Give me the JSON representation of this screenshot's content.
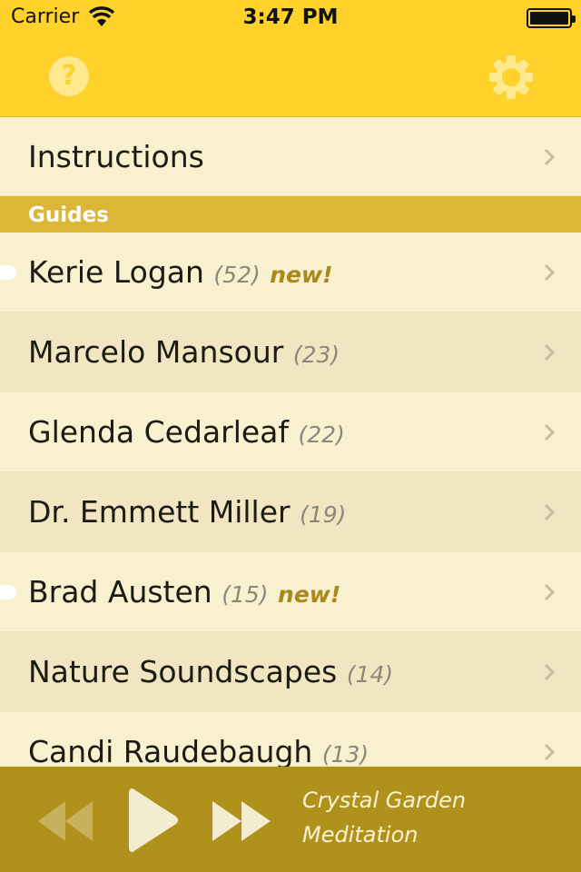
{
  "status_bar": {
    "carrier": "Carrier",
    "time": "3:47 PM"
  },
  "nav": {
    "help_symbol": "?",
    "help_icon": "question-circle-icon",
    "settings_icon": "gear-icon"
  },
  "instructions": {
    "label": "Instructions"
  },
  "guides_section": {
    "title": "Guides"
  },
  "guides": [
    {
      "name": "Kerie Logan",
      "count": "(52)",
      "badge": "new!",
      "unread": true
    },
    {
      "name": "Marcelo Mansour",
      "count": "(23)",
      "badge": "",
      "unread": false
    },
    {
      "name": "Glenda Cedarleaf",
      "count": "(22)",
      "badge": "",
      "unread": false
    },
    {
      "name": "Dr. Emmett Miller",
      "count": "(19)",
      "badge": "",
      "unread": false
    },
    {
      "name": "Brad Austen",
      "count": "(15)",
      "badge": "new!",
      "unread": true
    },
    {
      "name": "Nature Soundscapes",
      "count": "(14)",
      "badge": "",
      "unread": false
    },
    {
      "name": "Candi Raudebaugh",
      "count": "(13)",
      "badge": "",
      "unread": false
    }
  ],
  "player": {
    "now_playing_line1": "Crystal Garden",
    "now_playing_line2": "Meditation",
    "rewind_icon": "rewind-icon",
    "play_icon": "play-icon",
    "forward_icon": "fast-forward-icon"
  },
  "colors": {
    "header": "#fed22b",
    "section_header": "#dcb737",
    "row_light": "#f8f0cf",
    "row_dark": "#f1e6c1",
    "player": "#b0911b",
    "badge": "#a8891b"
  }
}
